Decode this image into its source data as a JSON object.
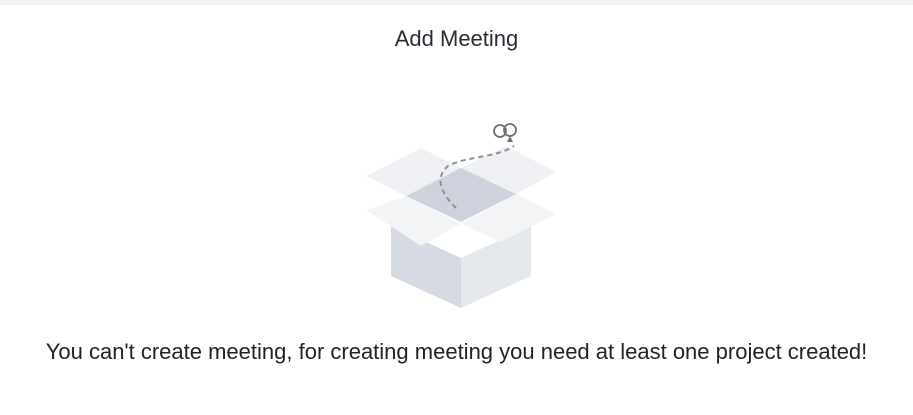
{
  "dialog": {
    "title": "Add Meeting",
    "empty_state": {
      "illustration": "open-empty-box-icon",
      "message": "You can't create meeting, for creating meeting you need at least one project created!"
    }
  },
  "colors": {
    "background": "#ffffff",
    "top_bar": "#f2f2f4",
    "box_dark": "#cdd2dc",
    "box_light": "#e2e5eb",
    "flap": "#f0f1f3",
    "dashed_line": "#8c8f95"
  }
}
